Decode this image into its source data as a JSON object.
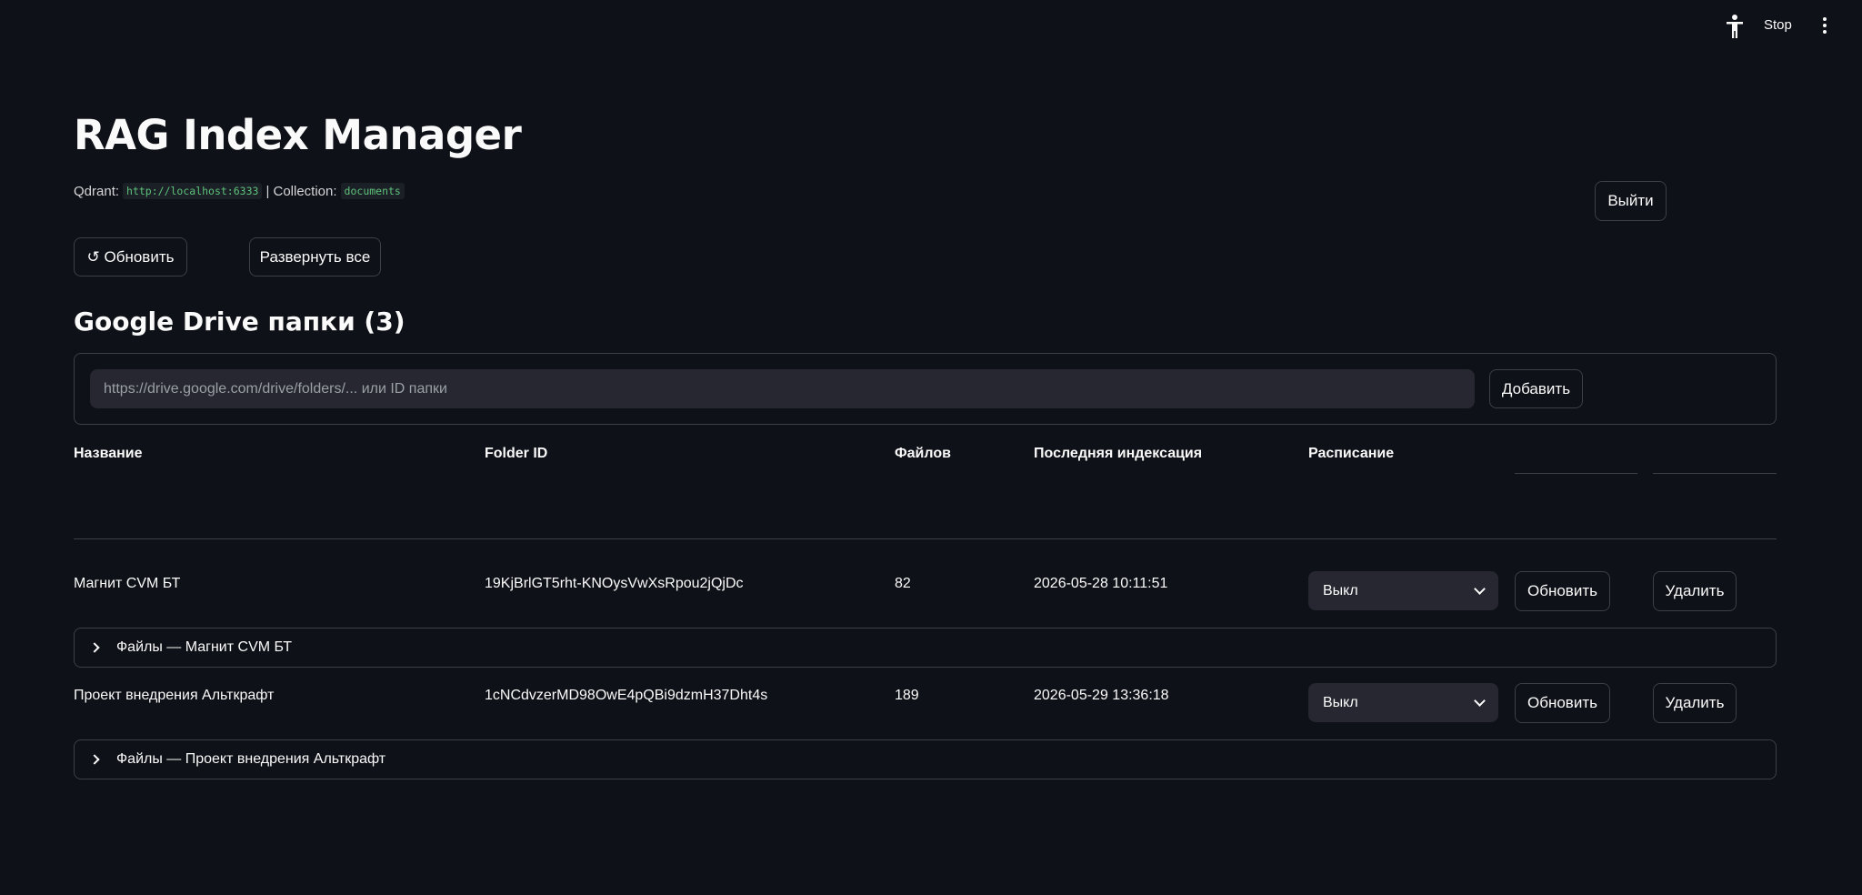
{
  "toolbar": {
    "stop_label": "Stop",
    "run_icon": "running-man-icon",
    "menu_icon": "kebab-menu-icon"
  },
  "header": {
    "title": "RAG Index Manager",
    "qdrant_label": "Qdrant:",
    "qdrant_url": "http://localhost:6333",
    "separator": "| Collection:",
    "collection": "documents",
    "logout_label": "Выйти"
  },
  "actions": {
    "refresh_label": "↺ Обновить",
    "expand_all_label": "Развернуть все"
  },
  "folders_section": {
    "title": "Google Drive папки (3)",
    "input_placeholder": "https://drive.google.com/drive/folders/... или ID папки",
    "input_value": "",
    "add_label": "Добавить"
  },
  "table": {
    "columns": [
      "Название",
      "Folder ID",
      "Файлов",
      "Последняя индексация",
      "Расписание"
    ],
    "rows": [
      {
        "name": "Магнит CVM БТ",
        "folder_id": "19KjBrlGT5rht-KNOysVwXsRpou2jQjDc",
        "files": "82",
        "last_indexed": "2026-05-28 10:11:51",
        "schedule": "Выкл",
        "refresh_label": "Обновить",
        "delete_label": "Удалить",
        "expander_label": "Файлы — Магнит CVM БТ"
      },
      {
        "name": "Проект внедрения Альткрафт",
        "folder_id": "1cNCdvzerMD98OwE4pQBi9dzmH37Dht4s",
        "files": "189",
        "last_indexed": "2026-05-29 13:36:18",
        "schedule": "Выкл",
        "refresh_label": "Обновить",
        "delete_label": "Удалить",
        "expander_label": "Файлы — Проект внедрения Альткрафт"
      }
    ]
  },
  "colors": {
    "background": "#0e1117",
    "border": "#3b3f48",
    "input_bg": "#262730",
    "code_green": "#5ec27a"
  }
}
